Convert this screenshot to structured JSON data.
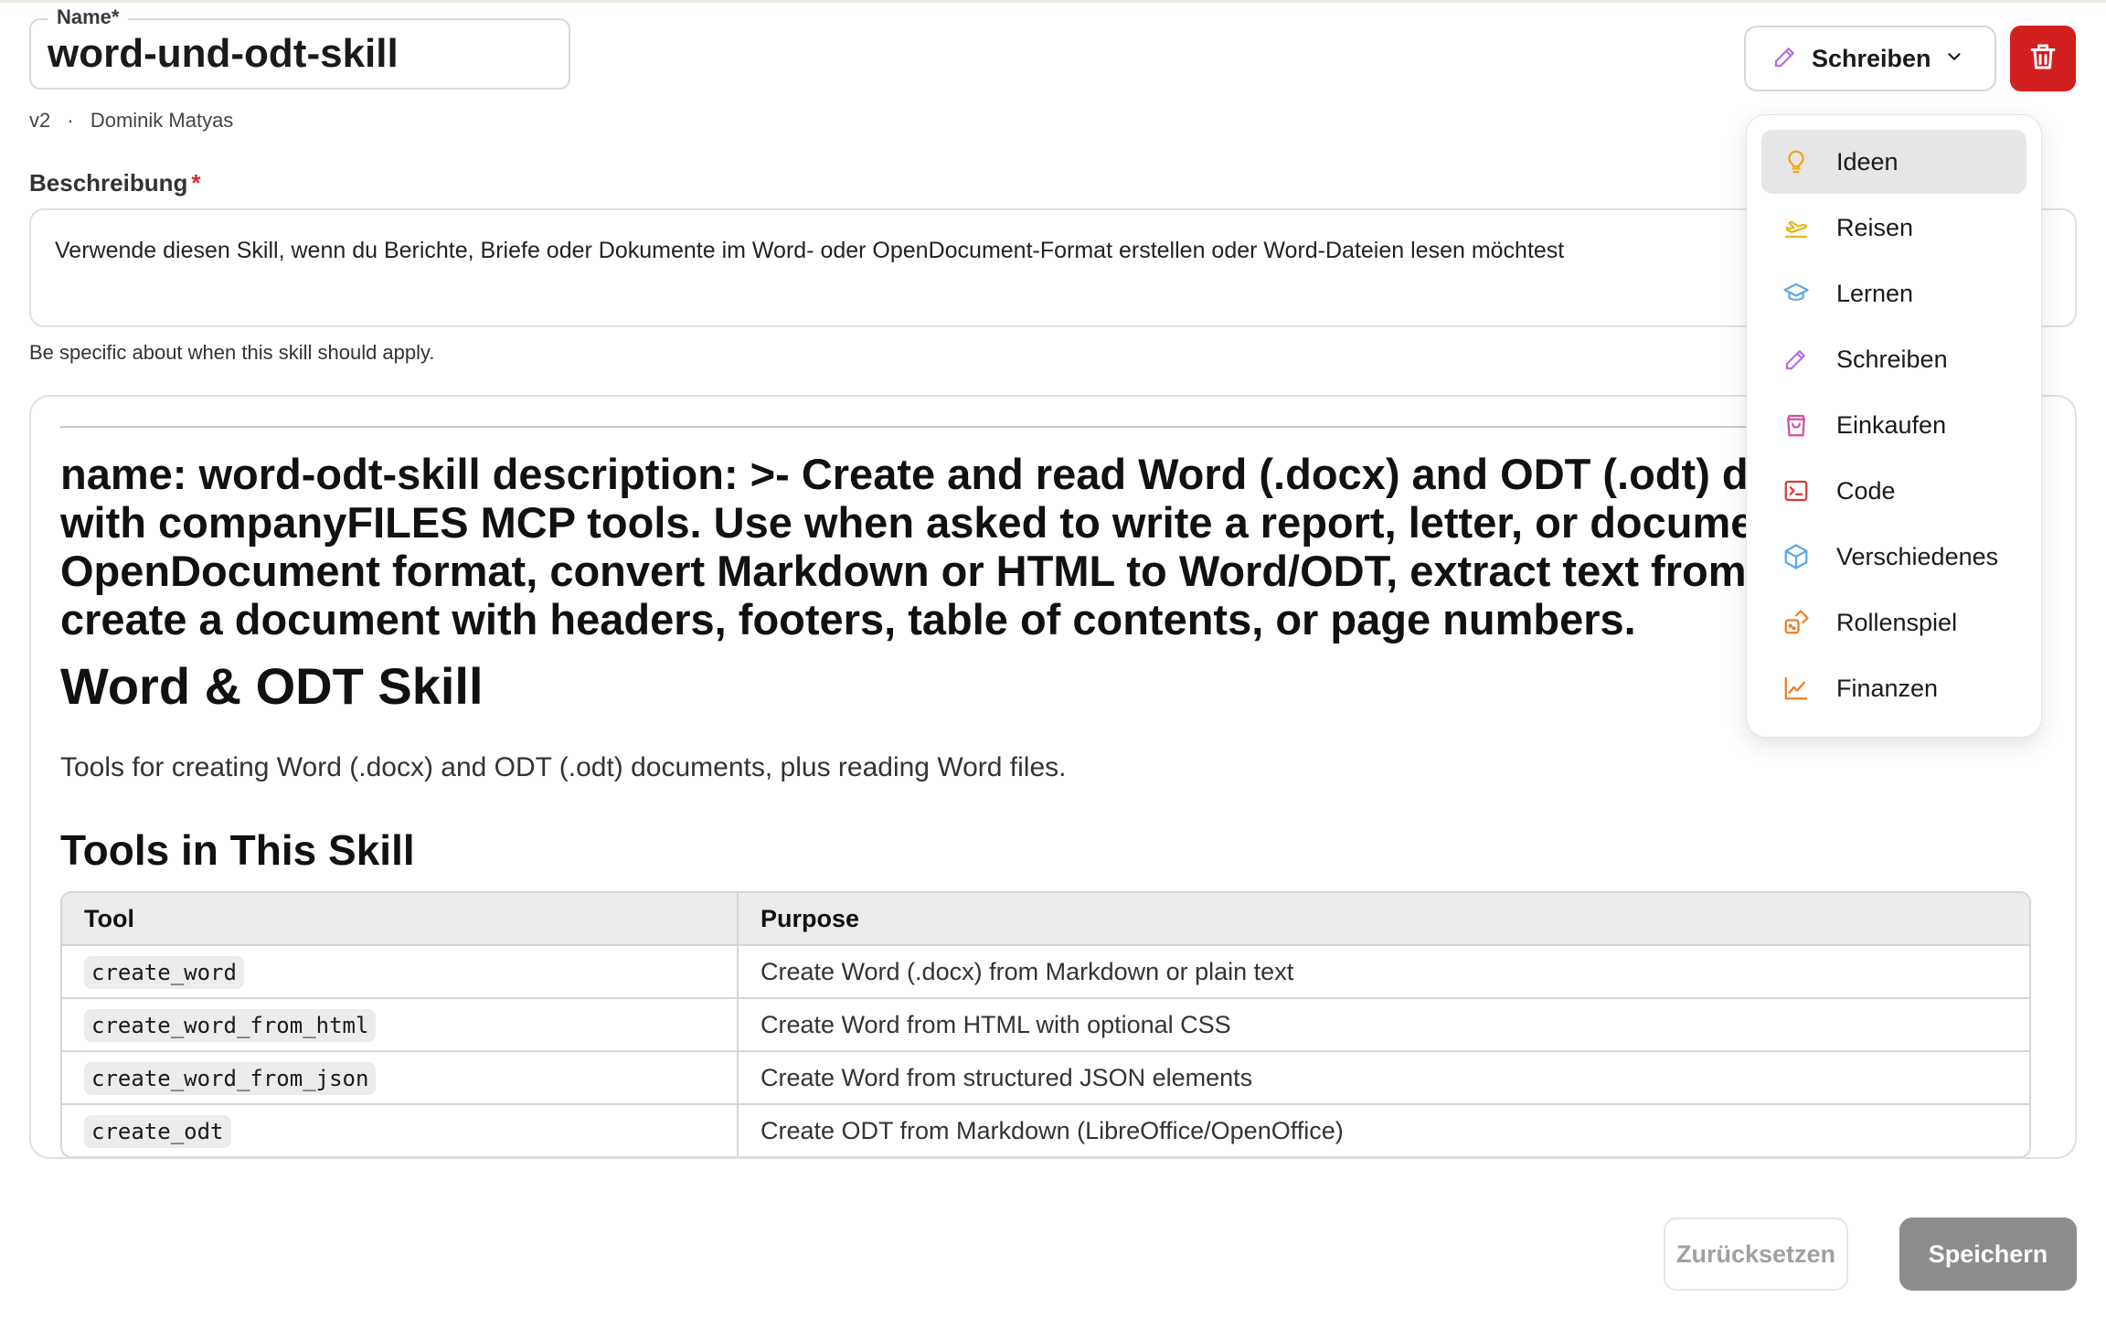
{
  "name_field": {
    "legend": "Name*",
    "value": "word-und-odt-skill"
  },
  "meta": {
    "version": "v2",
    "separator": "·",
    "author": "Dominik Matyas"
  },
  "description": {
    "label": "Beschreibung",
    "required_mark": "*",
    "value": "Verwende diesen Skill, wenn du Berichte, Briefe oder Dokumente im Word- oder OpenDocument-Format erstellen oder Word-Dateien lesen möchtest",
    "hint": "Be specific about when this skill should apply."
  },
  "editor": {
    "frontmatter_lines": [
      "name: word-odt-skill description: >- Create and read Word (.docx) and ODT (.odt) do",
      "with companyFILES MCP tools. Use when asked to write a report, letter, or document",
      "OpenDocument format, convert Markdown or HTML to Word/ODT, extract text from a",
      "create a document with headers, footers, table of contents, or page numbers."
    ],
    "h1": "Word & ODT Skill",
    "intro": "Tools for creating Word (.docx) and ODT (.odt) documents, plus reading Word files.",
    "h2": "Tools in This Skill",
    "table": {
      "headers": [
        "Tool",
        "Purpose"
      ],
      "rows": [
        [
          "create_word",
          "Create Word (.docx) from Markdown or plain text"
        ],
        [
          "create_word_from_html",
          "Create Word from HTML with optional CSS"
        ],
        [
          "create_word_from_json",
          "Create Word from structured JSON elements"
        ],
        [
          "create_odt",
          "Create ODT from Markdown (LibreOffice/OpenOffice)"
        ]
      ]
    }
  },
  "category": {
    "selected": "Schreiben",
    "items": [
      {
        "label": "Ideen",
        "icon": "lightbulb-icon",
        "color": "#f0a81c",
        "active": true
      },
      {
        "label": "Reisen",
        "icon": "plane-icon",
        "color": "#e8b81e",
        "active": false
      },
      {
        "label": "Lernen",
        "icon": "graduation-cap-icon",
        "color": "#5aa9e6",
        "active": false
      },
      {
        "label": "Schreiben",
        "icon": "pencil-icon",
        "color": "#b56ee8",
        "active": false
      },
      {
        "label": "Einkaufen",
        "icon": "shopping-bag-icon",
        "color": "#d14fa8",
        "active": false
      },
      {
        "label": "Code",
        "icon": "terminal-icon",
        "color": "#d93a3a",
        "active": false
      },
      {
        "label": "Verschiedenes",
        "icon": "box-icon",
        "color": "#5aa9e6",
        "active": false
      },
      {
        "label": "Rollenspiel",
        "icon": "dice-icon",
        "color": "#ef7d22",
        "active": false
      },
      {
        "label": "Finanzen",
        "icon": "chart-line-icon",
        "color": "#ef7d22",
        "active": false
      }
    ]
  },
  "actions": {
    "reset": "Zurücksetzen",
    "save": "Speichern"
  },
  "colors": {
    "delete": "#d21f1f",
    "save_disabled": "#8c8c8c",
    "required": "#d32f2f"
  }
}
